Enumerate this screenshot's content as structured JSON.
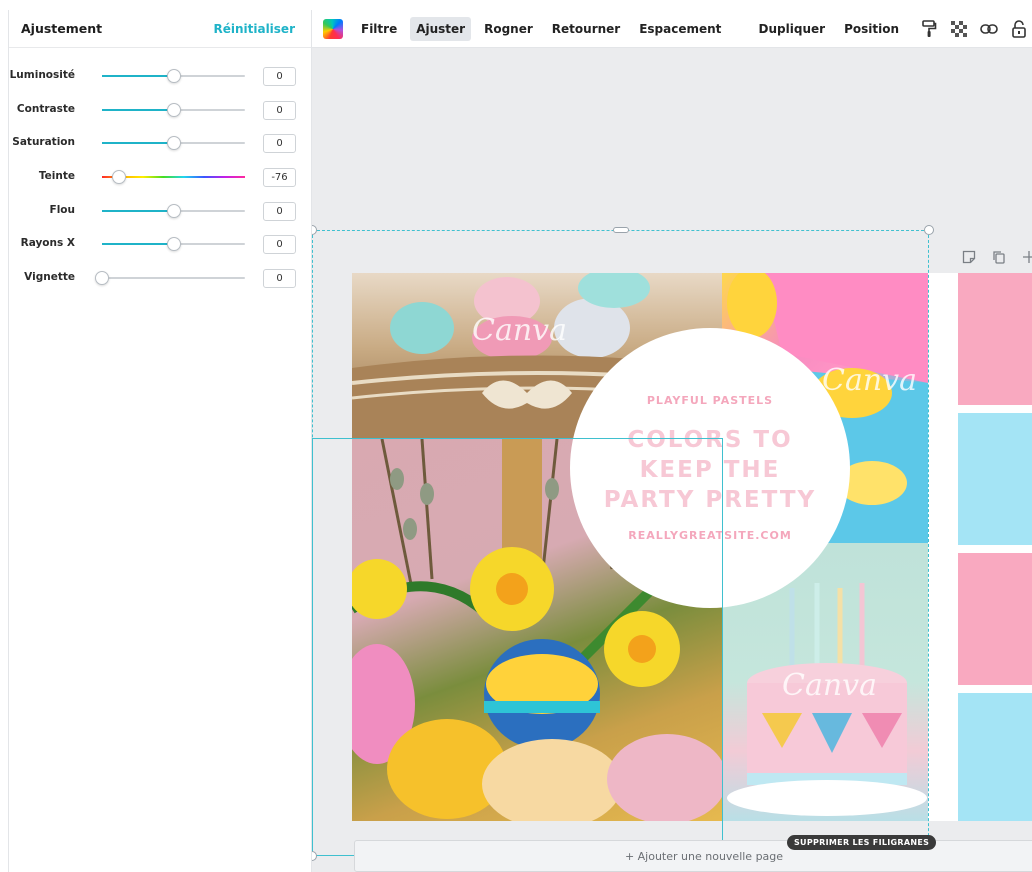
{
  "panel": {
    "title": "Ajustement",
    "reset_label": "Réinitialiser",
    "adjustments": [
      {
        "label": "Luminosité",
        "value": "0",
        "position": 0.5,
        "type": "normal"
      },
      {
        "label": "Contraste",
        "value": "0",
        "position": 0.5,
        "type": "normal"
      },
      {
        "label": "Saturation",
        "value": "0",
        "position": 0.5,
        "type": "normal"
      },
      {
        "label": "Teinte",
        "value": "-76",
        "position": 0.12,
        "type": "hue"
      },
      {
        "label": "Flou",
        "value": "0",
        "position": 0.5,
        "type": "normal"
      },
      {
        "label": "Rayons X",
        "value": "0",
        "position": 0.5,
        "type": "normal"
      },
      {
        "label": "Vignette",
        "value": "0",
        "position": 0.0,
        "type": "normal"
      }
    ]
  },
  "toolbar": {
    "items": [
      "Filtre",
      "Ajuster",
      "Rogner",
      "Retourner",
      "Espacement"
    ],
    "active": "Ajuster",
    "right_items": [
      "Dupliquer",
      "Position"
    ],
    "icons": [
      "paint-roller-icon",
      "transparency-icon",
      "link-icon",
      "lock-icon"
    ]
  },
  "design": {
    "subtitle": "PLAYFUL PASTELS",
    "headline": "COLORS TO KEEP THE PARTY PRETTY",
    "url": "REALLYGREATSITE.COM",
    "watermark_text": "Canva",
    "block_colors": [
      "#f9a9c0",
      "#a4e4f5",
      "#f9a9c0",
      "#a4e4f5"
    ]
  },
  "page_tools": [
    "note-icon",
    "duplicate-page-icon",
    "add-page-icon"
  ],
  "remove_watermark_label": "SUPPRIMER LES FILIGRANES",
  "add_page_label": "+ Ajouter une nouvelle page",
  "colors": {
    "accent": "#1fb3c8",
    "selection": "#3fc0cf"
  }
}
